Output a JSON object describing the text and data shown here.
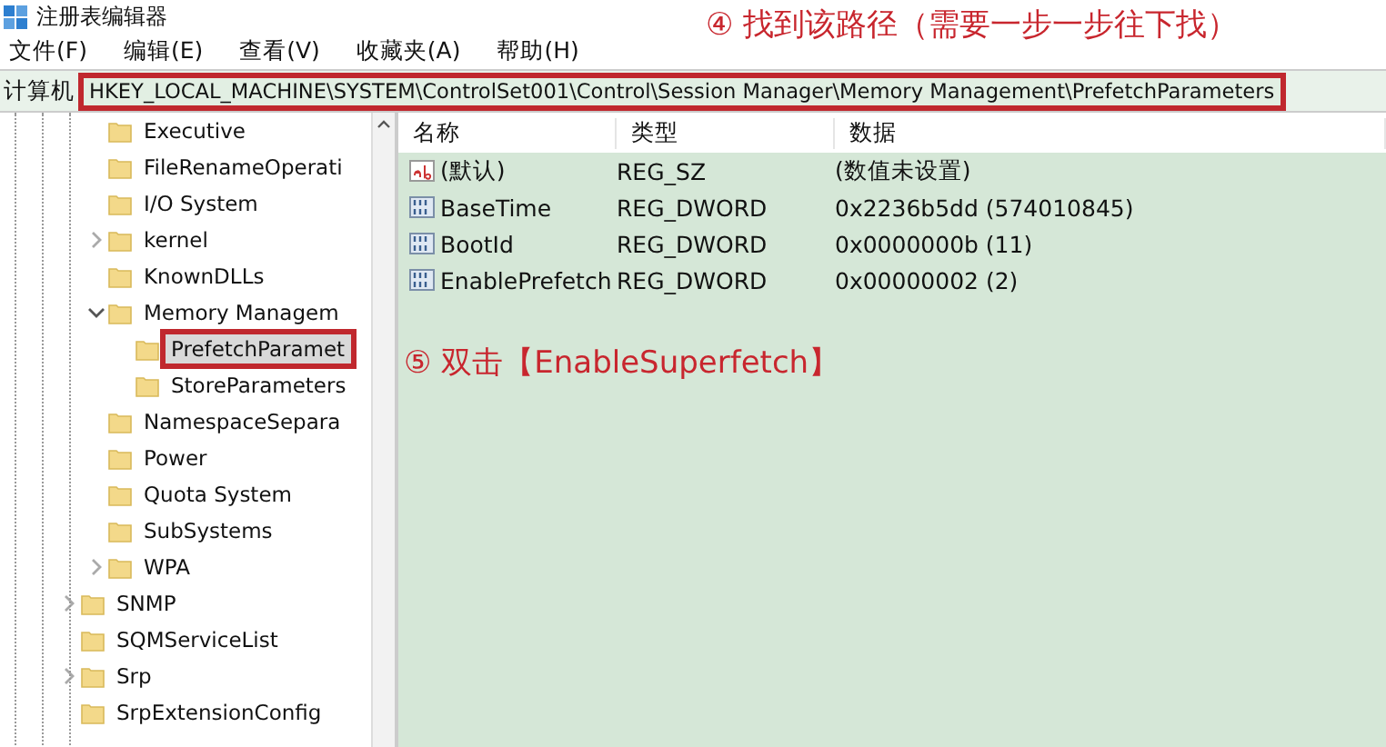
{
  "window": {
    "title": "注册表编辑器"
  },
  "menu": [
    "文件(F)",
    "编辑(E)",
    "查看(V)",
    "收藏夹(A)",
    "帮助(H)"
  ],
  "address": {
    "label": "计算机",
    "value": "HKEY_LOCAL_MACHINE\\SYSTEM\\ControlSet001\\Control\\Session Manager\\Memory Management\\PrefetchParameters"
  },
  "tree": [
    {
      "children": [
        {
          "label": "Executive",
          "expandable": false,
          "selected": false
        },
        {
          "label": "FileRenameOperati",
          "expandable": false,
          "selected": false
        },
        {
          "label": "I/O System",
          "expandable": false,
          "selected": false
        },
        {
          "label": "kernel",
          "expandable": true,
          "expanded": false,
          "selected": false
        },
        {
          "label": "KnownDLLs",
          "expandable": false,
          "selected": false
        },
        {
          "label": "Memory Managem",
          "expandable": true,
          "expanded": true,
          "selected": false,
          "children": [
            {
              "label": "PrefetchParamet",
              "expandable": false,
              "selected": true
            },
            {
              "label": "StoreParameters",
              "expandable": false,
              "selected": false
            }
          ]
        },
        {
          "label": "NamespaceSepara",
          "expandable": false,
          "selected": false
        },
        {
          "label": "Power",
          "expandable": false,
          "selected": false
        },
        {
          "label": "Quota System",
          "expandable": false,
          "selected": false
        },
        {
          "label": "SubSystems",
          "expandable": false,
          "selected": false
        },
        {
          "label": "WPA",
          "expandable": true,
          "expanded": false,
          "selected": false
        }
      ]
    },
    {
      "label": "SNMP",
      "expandable": true,
      "expanded": false,
      "selected": false
    },
    {
      "label": "SQMServiceList",
      "expandable": false,
      "selected": false
    },
    {
      "label": "Srp",
      "expandable": true,
      "expanded": false,
      "selected": false
    },
    {
      "label": "SrpExtensionConfig",
      "expandable": false,
      "selected": false
    }
  ],
  "values": {
    "columns": [
      "名称",
      "类型",
      "数据"
    ],
    "rows": [
      {
        "kind": "string",
        "name": "(默认)",
        "type": "REG_SZ",
        "data": "(数值未设置)"
      },
      {
        "kind": "dword",
        "name": "BaseTime",
        "type": "REG_DWORD",
        "data": "0x2236b5dd (574010845)"
      },
      {
        "kind": "dword",
        "name": "BootId",
        "type": "REG_DWORD",
        "data": "0x0000000b (11)"
      },
      {
        "kind": "dword",
        "name": "EnablePrefetch",
        "type": "REG_DWORD",
        "data": "0x00000002 (2)"
      }
    ]
  },
  "annotations": [
    "④ 找到该路径（需要一步一步往下找）",
    "⑤ 双击【EnableSuperfetch】"
  ]
}
